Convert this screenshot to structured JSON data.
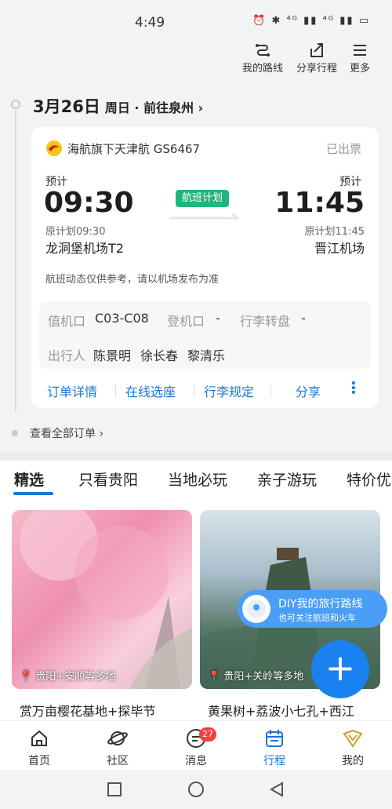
{
  "status_bar": {
    "time": "4:49",
    "icons": "⏰ ✱ ⁴ᴳ ▮▮ ⁴ᴳ ▮▮ ▭"
  },
  "top_actions": [
    {
      "label": "我的路线",
      "icon": "route-icon"
    },
    {
      "label": "分享行程",
      "icon": "share-icon"
    },
    {
      "label": "更多",
      "icon": "menu-icon"
    }
  ],
  "trip": {
    "date": "3月26日",
    "sub": "周日 · 前往泉州 ›",
    "airline": "海航旗下天津航 GS6467",
    "ticket_status": "已出票",
    "dep_label": "预计",
    "dep_time": "09:30",
    "dep_plan": "原计划09:30",
    "dep_airport": "龙洞堡机场T2",
    "arr_label": "预计",
    "arr_time": "11:45",
    "arr_plan": "原计划11:45",
    "arr_airport": "晋江机场",
    "flight_plan_badge": "航班计划",
    "note": "航班动态仅供参考，请以机场发布为准",
    "checkin_label": "值机口",
    "checkin_value": "C03-C08",
    "gate_label": "登机口",
    "gate_value": "-",
    "baggage_label": "行李转盘",
    "baggage_value": "-",
    "passenger_label": "出行人",
    "passengers": [
      "陈景明",
      "徐长春",
      "黎清乐"
    ],
    "actions": [
      "订单详情",
      "在线选座",
      "行李规定",
      "分享"
    ],
    "more": "⋮"
  },
  "all_orders": "查看全部订单 ›",
  "tabs": [
    "精选",
    "只看贵阳",
    "当地必玩",
    "亲子游玩",
    "特价优"
  ],
  "cards": [
    {
      "location": "贵阳+安顺等多地",
      "caption": "赏万亩樱花基地+探毕节"
    },
    {
      "location": "贵阳+关岭等多地",
      "caption": "黄果树+荔波小七孔+西江"
    }
  ],
  "diy": {
    "title": "DIY我的旅行路线",
    "subtitle": "也可关注航班和火车"
  },
  "fab": "+",
  "bottom_nav": [
    {
      "label": "首页",
      "icon": "home-icon"
    },
    {
      "label": "社区",
      "icon": "planet-icon"
    },
    {
      "label": "消息",
      "icon": "message-icon",
      "badge": "27"
    },
    {
      "label": "行程",
      "icon": "calendar-icon",
      "active": true
    },
    {
      "label": "我的",
      "icon": "profile-icon"
    }
  ],
  "colors": {
    "accent": "#1677d9",
    "green": "#21b57b",
    "badge": "#f43f3f"
  }
}
